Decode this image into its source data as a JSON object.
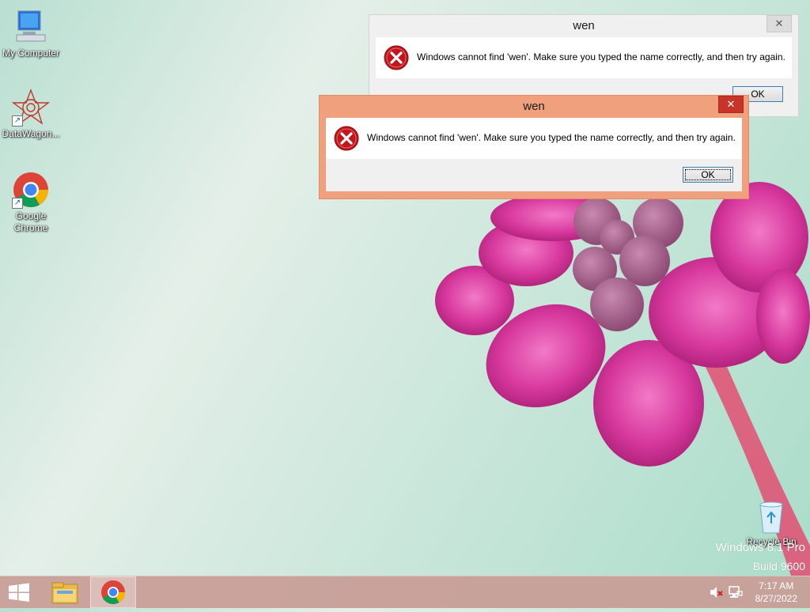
{
  "desktop": {
    "icons": [
      {
        "label": "My Computer",
        "icon": "computer-icon"
      },
      {
        "label": "DataWagon...",
        "icon": "datawagon-icon"
      },
      {
        "label": "Google Chrome",
        "icon": "chrome-icon"
      },
      {
        "label": "Recycle Bin",
        "icon": "recycle-bin-icon"
      }
    ],
    "watermark": {
      "line1": "Windows 8.1 Pro",
      "line2": "Build 9600"
    }
  },
  "dialogs": {
    "back": {
      "title": "wen",
      "message": "Windows cannot find 'wen'. Make sure you typed the name correctly, and then try again.",
      "ok_label": "OK",
      "close_symbol": "✕"
    },
    "front": {
      "title": "wen",
      "message": "Windows cannot find 'wen'. Make sure you typed the name correctly, and then try again.",
      "ok_label": "OK",
      "close_symbol": "✕"
    }
  },
  "taskbar": {
    "start_icon": "windows-logo-icon",
    "pinned": [
      {
        "name": "File Explorer",
        "icon": "folder-icon"
      },
      {
        "name": "Google Chrome",
        "icon": "chrome-icon",
        "active": true
      }
    ],
    "tray": {
      "volume": "volume-muted-icon",
      "network": "network-icon"
    },
    "time": "7:17 AM",
    "date": "8/27/2022"
  },
  "colors": {
    "active_dialog_border": "#f0a07c",
    "close_button_red": "#c7352a",
    "taskbar": "#c89c96",
    "error_red": "#c0161c"
  }
}
